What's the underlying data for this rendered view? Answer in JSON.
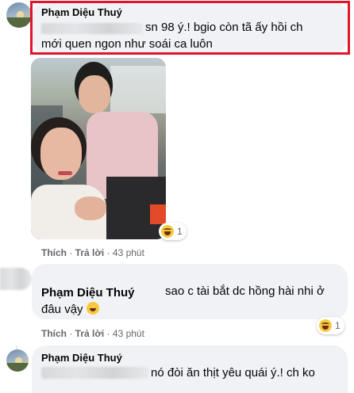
{
  "comments": [
    {
      "author": "Phạm Diệu Thuý",
      "text_line1": "sn 98 ý.! bgio còn tã ấy hồi ch",
      "text_line2": "mới quen ngon như soái ca luôn",
      "reaction_count": "1",
      "actions": {
        "like": "Thích",
        "reply": "Trả lời",
        "time": "43 phút"
      },
      "highlight_color": "#e0152a"
    },
    {
      "author": "Phạm Diệu Thuý",
      "text_line1": "sao c tài bắt dc hồng hài nhi ở",
      "text_line2": "đâu vậy",
      "reaction_count": "1",
      "actions": {
        "like": "Thích",
        "reply": "Trả lời",
        "time": "43 phút"
      }
    },
    {
      "author": "Phạm Diệu Thuý",
      "text_line1": "nó đòi ăn thịt yêu quái ý.! ch ko"
    }
  ],
  "reaction_icon": "haha-icon",
  "colors": {
    "bubble": "#f0f2f5",
    "meta": "#65676b"
  }
}
